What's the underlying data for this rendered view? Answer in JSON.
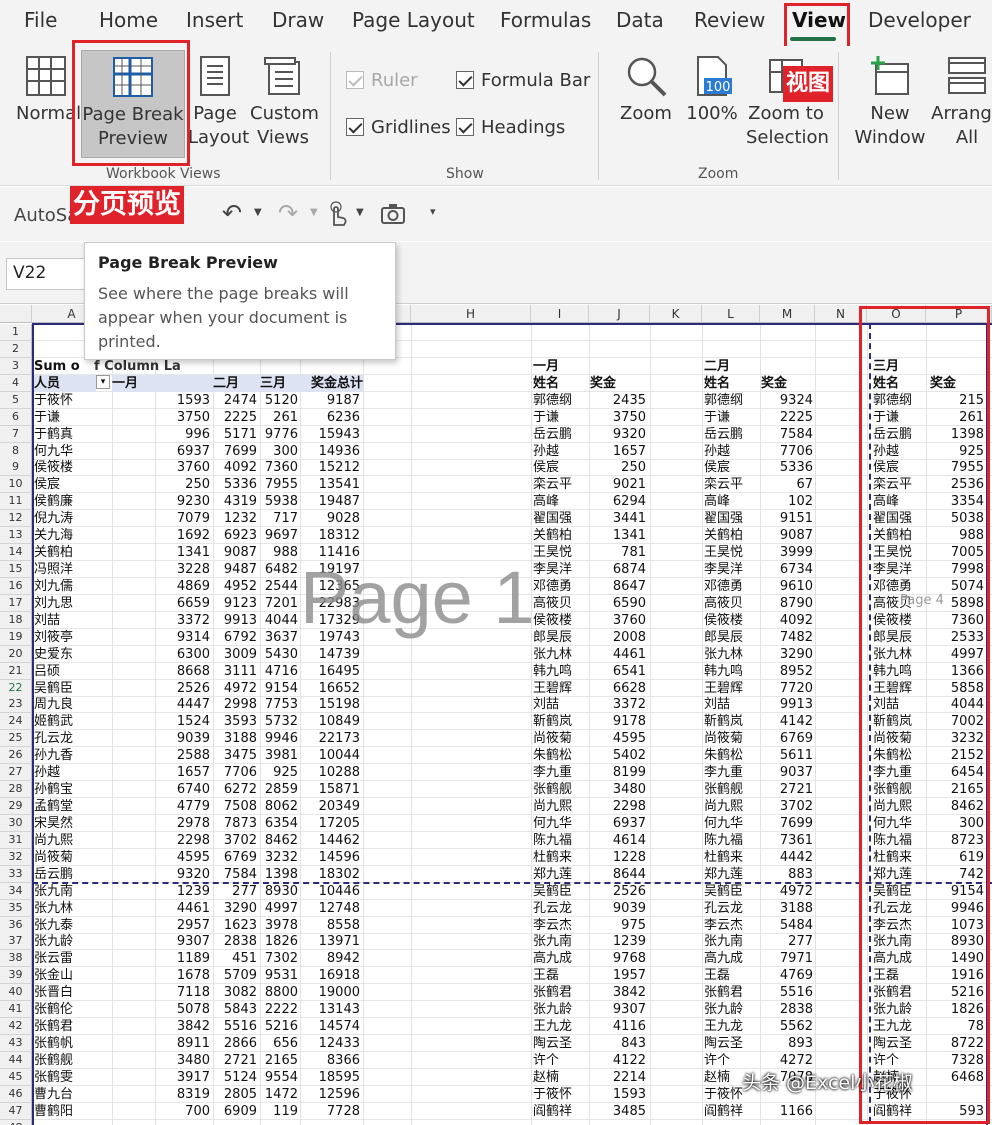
{
  "tabs": [
    "File",
    "Home",
    "Insert",
    "Draw",
    "Page Layout",
    "Formulas",
    "Data",
    "Review",
    "View",
    "Developer"
  ],
  "active_tab": "View",
  "ribbon": {
    "normal": "Normal",
    "page_break_preview": [
      "Page Break",
      "Preview"
    ],
    "page_layout": [
      "Page",
      "Layout"
    ],
    "custom_views": [
      "Custom",
      "Views"
    ],
    "workbook_views_label": "Workbook Views",
    "show_label": "Show",
    "zoom_label": "Zoom",
    "ruler": "Ruler",
    "formula_bar": "Formula Bar",
    "gridlines": "Gridlines",
    "headings": "Headings",
    "zoom": "Zoom",
    "zoom100": "100%",
    "zoom100_icon_text": "100",
    "zoom_selection": [
      "Zoom to",
      "Selection"
    ],
    "new_window": [
      "New",
      "Window"
    ],
    "arrange_all": [
      "Arrange",
      "All"
    ]
  },
  "annotations": {
    "view_cn": "视图",
    "page_break_cn": "分页预览"
  },
  "qat": {
    "autosave": "AutoSa"
  },
  "tooltip": {
    "title": "Page Break Preview",
    "desc": "See where the page breaks will appear when your document is printed."
  },
  "namebox": "V22",
  "columns": [
    "A",
    "B",
    "C",
    "D",
    "E",
    "F",
    "G",
    "H",
    "I",
    "J",
    "K",
    "L",
    "M",
    "N",
    "O",
    "P"
  ],
  "pivot": {
    "sum_label": "Sum o",
    "sum_tail": "f Column La",
    "h_person": "人员",
    "h_jan": "一月",
    "h_feb": "二月",
    "h_mar": "三月",
    "h_total": "奖金总计"
  },
  "section_jan": {
    "month": "一月",
    "name": "姓名",
    "bonus": "奖金"
  },
  "section_feb": {
    "month": "二月",
    "name": "姓名",
    "bonus": "奖金"
  },
  "section_mar": {
    "month": "三月",
    "name": "姓名",
    "bonus": "奖金"
  },
  "pivot_rows": [
    [
      "于筱怀",
      1593,
      2474,
      5120,
      9187
    ],
    [
      "于谦",
      3750,
      2225,
      261,
      6236
    ],
    [
      "于鹤真",
      996,
      5171,
      9776,
      15943
    ],
    [
      "何九华",
      6937,
      7699,
      300,
      14936
    ],
    [
      "侯筱楼",
      3760,
      4092,
      7360,
      15212
    ],
    [
      "侯宸",
      250,
      5336,
      7955,
      13541
    ],
    [
      "侯鹤廉",
      9230,
      4319,
      5938,
      19487
    ],
    [
      "倪九涛",
      7079,
      1232,
      717,
      9028
    ],
    [
      "关九海",
      1692,
      6923,
      9697,
      18312
    ],
    [
      "关鹤柏",
      1341,
      9087,
      988,
      11416
    ],
    [
      "冯照洋",
      3228,
      9487,
      6482,
      19197
    ],
    [
      "刘九儒",
      4869,
      4952,
      2544,
      12365
    ],
    [
      "刘九思",
      6659,
      9123,
      7201,
      22983
    ],
    [
      "刘喆",
      3372,
      9913,
      4044,
      17329
    ],
    [
      "刘筱亭",
      9314,
      6792,
      3637,
      19743
    ],
    [
      "史爱东",
      6300,
      3009,
      5430,
      14739
    ],
    [
      "吕硕",
      8668,
      3111,
      4716,
      16495
    ],
    [
      "吴鹤臣",
      2526,
      4972,
      9154,
      16652
    ],
    [
      "周九良",
      4447,
      2998,
      7753,
      15198
    ],
    [
      "姬鹤武",
      1524,
      3593,
      5732,
      10849
    ],
    [
      "孔云龙",
      9039,
      3188,
      9946,
      22173
    ],
    [
      "孙九香",
      2588,
      3475,
      3981,
      10044
    ],
    [
      "孙越",
      1657,
      7706,
      925,
      10288
    ],
    [
      "孙鹤宝",
      6740,
      6272,
      2859,
      15871
    ],
    [
      "孟鹤堂",
      4779,
      7508,
      8062,
      20349
    ],
    [
      "宋昊然",
      2978,
      7873,
      6354,
      17205
    ],
    [
      "尚九熙",
      2298,
      3702,
      8462,
      14462
    ],
    [
      "尚筱菊",
      4595,
      6769,
      3232,
      14596
    ],
    [
      "岳云鹏",
      9320,
      7584,
      1398,
      18302
    ],
    [
      "张九南",
      1239,
      277,
      8930,
      10446
    ],
    [
      "张九林",
      4461,
      3290,
      4997,
      12748
    ],
    [
      "张九泰",
      2957,
      1623,
      3978,
      8558
    ],
    [
      "张九龄",
      9307,
      2838,
      1826,
      13971
    ],
    [
      "张云雷",
      1189,
      451,
      7302,
      8942
    ],
    [
      "张金山",
      1678,
      5709,
      9531,
      16918
    ],
    [
      "张晋白",
      7118,
      3082,
      8800,
      19000
    ],
    [
      "张鹤伦",
      5078,
      5843,
      2222,
      13143
    ],
    [
      "张鹤君",
      3842,
      5516,
      5216,
      14574
    ],
    [
      "张鹤帆",
      8911,
      2866,
      656,
      12433
    ],
    [
      "张鹤舰",
      3480,
      2721,
      2165,
      8366
    ],
    [
      "张鹤雯",
      3917,
      5124,
      9554,
      18595
    ],
    [
      "曹九台",
      8319,
      2805,
      1472,
      12596
    ],
    [
      "曹鹤阳",
      700,
      6909,
      119,
      7728
    ]
  ],
  "jan_rows": [
    [
      "郭德纲",
      2435
    ],
    [
      "于谦",
      3750
    ],
    [
      "岳云鹏",
      9320
    ],
    [
      "孙越",
      1657
    ],
    [
      "侯宸",
      250
    ],
    [
      "栾云平",
      9021
    ],
    [
      "高峰",
      6294
    ],
    [
      "翟国强",
      3441
    ],
    [
      "关鹤柏",
      1341
    ],
    [
      "王昊悦",
      781
    ],
    [
      "李昊洋",
      6874
    ],
    [
      "邓德勇",
      8647
    ],
    [
      "高筱贝",
      6590
    ],
    [
      "侯筱楼",
      3760
    ],
    [
      "郎昊辰",
      2008
    ],
    [
      "张九林",
      4461
    ],
    [
      "韩九鸣",
      6541
    ],
    [
      "王碧辉",
      6628
    ],
    [
      "刘喆",
      3372
    ],
    [
      "靳鹤岚",
      9178
    ],
    [
      "尚筱菊",
      4595
    ],
    [
      "朱鹤松",
      5402
    ],
    [
      "李九重",
      8199
    ],
    [
      "张鹤舰",
      3480
    ],
    [
      "尚九熙",
      2298
    ],
    [
      "何九华",
      6937
    ],
    [
      "陈九福",
      4614
    ],
    [
      "杜鹤来",
      1228
    ],
    [
      "郑九莲",
      8644
    ],
    [
      "吴鹤臣",
      2526
    ],
    [
      "孔云龙",
      9039
    ],
    [
      "李云杰",
      975
    ],
    [
      "张九南",
      1239
    ],
    [
      "高九成",
      9768
    ],
    [
      "王磊",
      1957
    ],
    [
      "张鹤君",
      3842
    ],
    [
      "张九龄",
      9307
    ],
    [
      "王九龙",
      4116
    ],
    [
      "陶云圣",
      843
    ],
    [
      "许个",
      4122
    ],
    [
      "赵楠",
      2214
    ],
    [
      "于筱怀",
      1593
    ],
    [
      "阎鹤祥",
      3485
    ]
  ],
  "feb_rows": [
    [
      "郭德纲",
      9324
    ],
    [
      "于谦",
      2225
    ],
    [
      "岳云鹏",
      7584
    ],
    [
      "孙越",
      7706
    ],
    [
      "侯宸",
      5336
    ],
    [
      "栾云平",
      67
    ],
    [
      "高峰",
      102
    ],
    [
      "翟国强",
      9151
    ],
    [
      "关鹤柏",
      9087
    ],
    [
      "王昊悦",
      3999
    ],
    [
      "李昊洋",
      6734
    ],
    [
      "邓德勇",
      9610
    ],
    [
      "高筱贝",
      8790
    ],
    [
      "侯筱楼",
      4092
    ],
    [
      "郎昊辰",
      7482
    ],
    [
      "张九林",
      3290
    ],
    [
      "韩九鸣",
      8952
    ],
    [
      "王碧辉",
      7720
    ],
    [
      "刘喆",
      9913
    ],
    [
      "靳鹤岚",
      4142
    ],
    [
      "尚筱菊",
      6769
    ],
    [
      "朱鹤松",
      5611
    ],
    [
      "李九重",
      9037
    ],
    [
      "张鹤舰",
      2721
    ],
    [
      "尚九熙",
      3702
    ],
    [
      "何九华",
      7699
    ],
    [
      "陈九福",
      7361
    ],
    [
      "杜鹤来",
      4442
    ],
    [
      "郑九莲",
      883
    ],
    [
      "吴鹤臣",
      4972
    ],
    [
      "孔云龙",
      3188
    ],
    [
      "李云杰",
      5484
    ],
    [
      "张九南",
      277
    ],
    [
      "高九成",
      7971
    ],
    [
      "王磊",
      4769
    ],
    [
      "张鹤君",
      5516
    ],
    [
      "张九龄",
      2838
    ],
    [
      "王九龙",
      5562
    ],
    [
      "陶云圣",
      893
    ],
    [
      "许个",
      4272
    ],
    [
      "赵楠",
      7078
    ],
    [
      "于筱怀",
      ""
    ],
    [
      "阎鹤祥",
      1166
    ]
  ],
  "mar_rows": [
    [
      "郭德纲",
      215
    ],
    [
      "于谦",
      261
    ],
    [
      "岳云鹏",
      1398
    ],
    [
      "孙越",
      925
    ],
    [
      "侯宸",
      7955
    ],
    [
      "栾云平",
      2536
    ],
    [
      "高峰",
      3354
    ],
    [
      "翟国强",
      5038
    ],
    [
      "关鹤柏",
      988
    ],
    [
      "王昊悦",
      7005
    ],
    [
      "李昊洋",
      7998
    ],
    [
      "邓德勇",
      5074
    ],
    [
      "高筱贝",
      5898
    ],
    [
      "侯筱楼",
      7360
    ],
    [
      "郎昊辰",
      2533
    ],
    [
      "张九林",
      4997
    ],
    [
      "韩九鸣",
      1366
    ],
    [
      "王碧辉",
      5858
    ],
    [
      "刘喆",
      4044
    ],
    [
      "靳鹤岚",
      7002
    ],
    [
      "尚筱菊",
      3232
    ],
    [
      "朱鹤松",
      2152
    ],
    [
      "李九重",
      6454
    ],
    [
      "张鹤舰",
      2165
    ],
    [
      "尚九熙",
      8462
    ],
    [
      "何九华",
      300
    ],
    [
      "陈九福",
      8723
    ],
    [
      "杜鹤来",
      619
    ],
    [
      "郑九莲",
      742
    ],
    [
      "吴鹤臣",
      9154
    ],
    [
      "孔云龙",
      9946
    ],
    [
      "李云杰",
      1073
    ],
    [
      "张九南",
      8930
    ],
    [
      "高九成",
      1490
    ],
    [
      "王磊",
      1916
    ],
    [
      "张鹤君",
      5216
    ],
    [
      "张九龄",
      1826
    ],
    [
      "王九龙",
      78
    ],
    [
      "陶云圣",
      8722
    ],
    [
      "许个",
      7328
    ],
    [
      "赵楠",
      6468
    ],
    [
      "于筱怀",
      ""
    ],
    [
      "阎鹤祥",
      593
    ]
  ],
  "watermark_page1": "Page 1",
  "watermark_page4": "Page 4",
  "corner_watermark": "头条 @Excel小花椒"
}
